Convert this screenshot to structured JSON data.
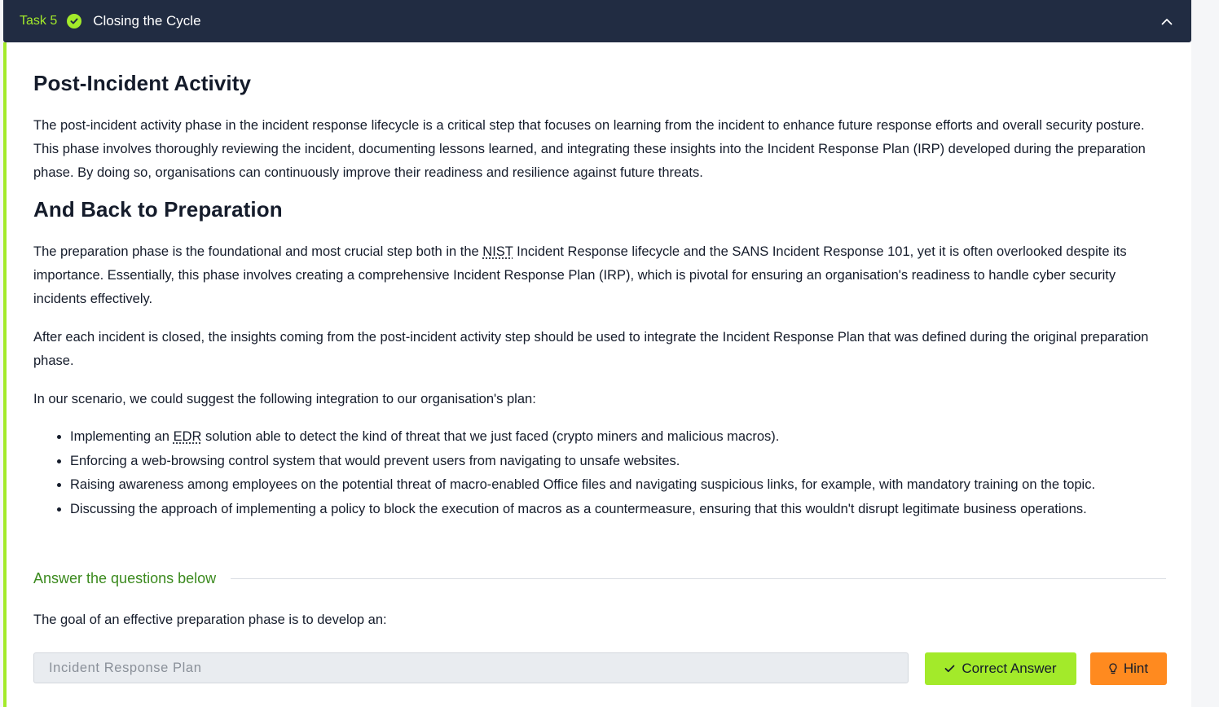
{
  "task": {
    "label": "Task 5",
    "title": "Closing the Cycle",
    "status_icon": "check-circle-icon",
    "collapse_icon": "chevron-up-icon"
  },
  "sections": {
    "post_incident": {
      "heading": "Post-Incident Activity",
      "paragraph": "The post-incident activity phase in the incident response lifecycle is a critical step that focuses on learning from the incident to enhance future response efforts and overall security posture. This phase involves thoroughly reviewing the incident, documenting lessons learned, and integrating these insights into the Incident Response Plan (IRP) developed during the preparation phase. By doing so, organisations can continuously improve their readiness and resilience against future threats."
    },
    "back_to_prep": {
      "heading": "And Back to Preparation",
      "p1_before": "The preparation phase is the foundational and most crucial step both in the ",
      "p1_abbr": "NIST",
      "p1_after": " Incident Response lifecycle and the SANS Incident Response 101, yet it is often overlooked despite its importance. Essentially, this phase involves creating a comprehensive Incident Response Plan (IRP), which is pivotal for ensuring an organisation's readiness to handle cyber security incidents effectively.",
      "p2": "After each incident is closed, the insights coming from the post-incident activity step should be used to integrate the Incident Response Plan that was defined during the original preparation phase.",
      "p3": "In our scenario, we could suggest the following integration to our organisation's plan:",
      "list": {
        "item1_before": "Implementing an ",
        "item1_abbr": "EDR",
        "item1_after": " solution able to detect the kind of threat that we just faced (crypto miners and malicious macros).",
        "item2": "Enforcing a web-browsing control system that would prevent users from navigating to unsafe websites.",
        "item3": "Raising awareness among employees on the potential threat of macro-enabled Office files and navigating suspicious links, for example, with mandatory training on the topic.",
        "item4": "Discussing the approach of implementing a policy to block the execution of macros as a countermeasure, ensuring that this wouldn't disrupt legitimate business operations."
      }
    }
  },
  "questions": {
    "heading": "Answer the questions below",
    "q1": {
      "text": "The goal of an effective preparation phase is to develop an:",
      "answer_value": "Incident Response Plan",
      "correct_label": "Correct Answer",
      "hint_label": "Hint"
    }
  },
  "colors": {
    "accent": "#a3ea2a",
    "header_bg": "#212c42",
    "hint": "#ff8a1f",
    "answer_heading": "#3b8a1e"
  }
}
